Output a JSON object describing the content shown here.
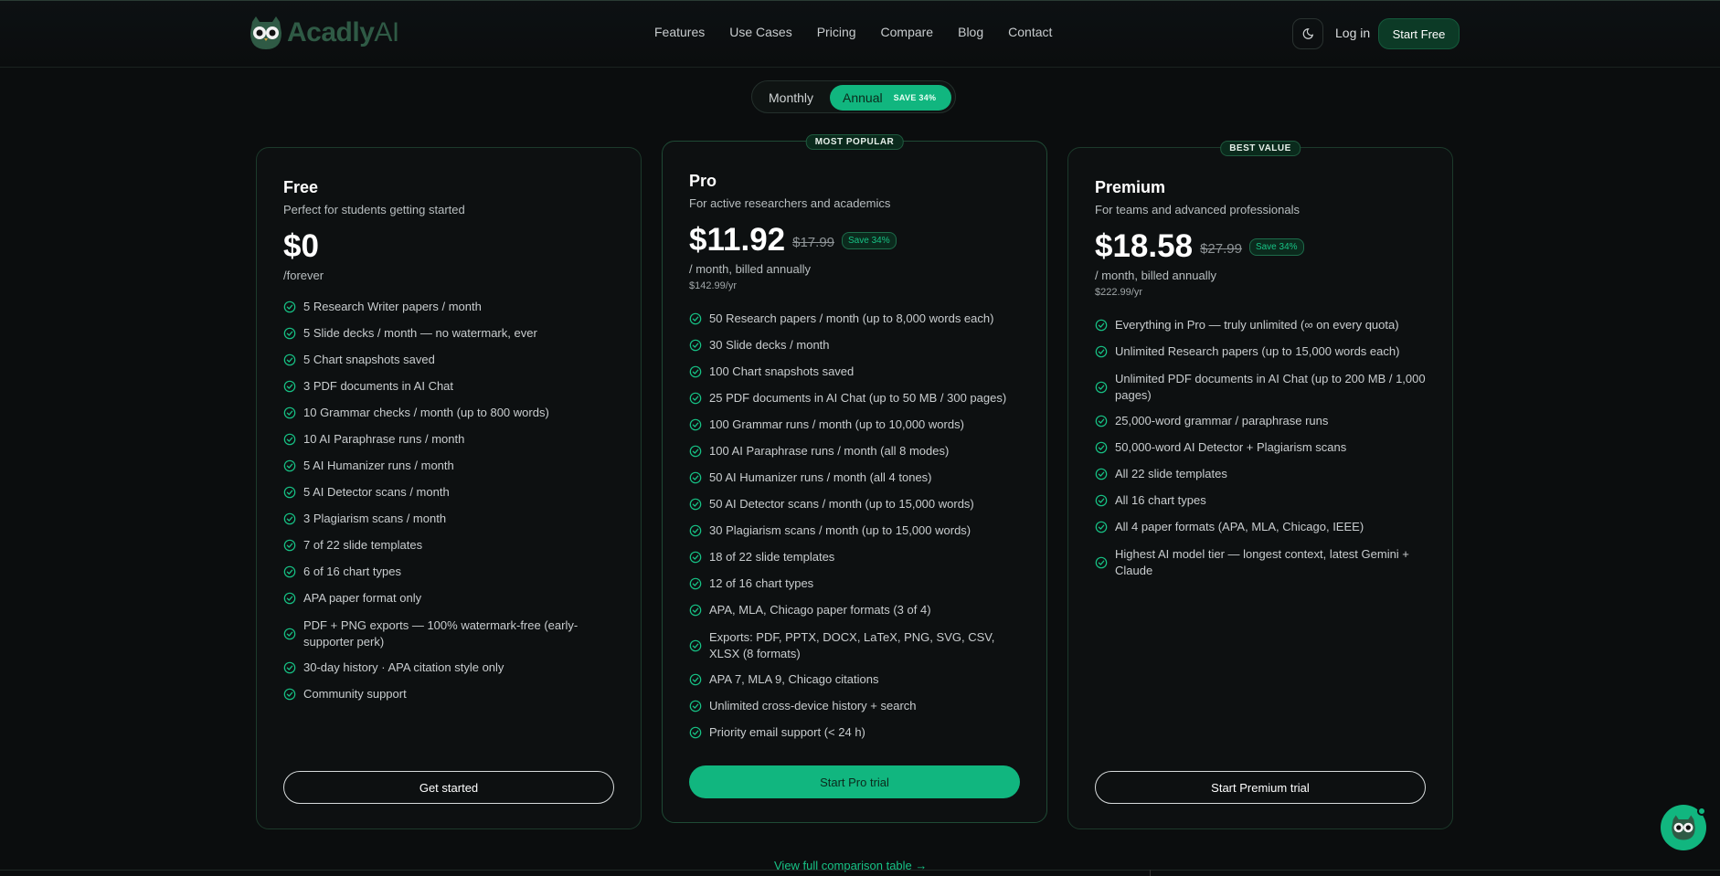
{
  "header": {
    "brand_main": "Acadly",
    "brand_ai": "AI",
    "nav": [
      "Features",
      "Use Cases",
      "Pricing",
      "Compare",
      "Blog",
      "Contact"
    ],
    "login": "Log in",
    "start_free": "Start Free"
  },
  "billing_toggle": {
    "monthly": "Monthly",
    "annual": "Annual",
    "save": "SAVE 34%"
  },
  "plans": {
    "free": {
      "name": "Free",
      "description": "Perfect for students getting started",
      "price": "$0",
      "period": "/forever",
      "features": [
        "5 Research Writer papers / month",
        "5 Slide decks / month — no watermark, ever",
        "5 Chart snapshots saved",
        "3 PDF documents in AI Chat",
        "10 Grammar checks / month (up to 800 words)",
        "10 AI Paraphrase runs / month",
        "5 AI Humanizer runs / month",
        "5 AI Detector scans / month",
        "3 Plagiarism scans / month",
        "7 of 22 slide templates",
        "6 of 16 chart types",
        "APA paper format only",
        "PDF + PNG exports — 100% watermark-free (early-supporter perk)",
        "30-day history · APA citation style only",
        "Community support"
      ],
      "cta": "Get started"
    },
    "pro": {
      "badge": "MOST POPULAR",
      "name": "Pro",
      "description": "For active researchers and academics",
      "price": "$11.92",
      "old_price": "$17.99",
      "save": "Save 34%",
      "period": "/ month, billed annually",
      "yearly": "$142.99/yr",
      "features": [
        "50 Research papers / month (up to 8,000 words each)",
        "30 Slide decks / month",
        "100 Chart snapshots saved",
        "25 PDF documents in AI Chat (up to 50 MB / 300 pages)",
        "100 Grammar runs / month (up to 10,000 words)",
        "100 AI Paraphrase runs / month (all 8 modes)",
        "50 AI Humanizer runs / month (all 4 tones)",
        "50 AI Detector scans / month (up to 15,000 words)",
        "30 Plagiarism scans / month (up to 15,000 words)",
        "18 of 22 slide templates",
        "12 of 16 chart types",
        "APA, MLA, Chicago paper formats (3 of 4)",
        "Exports: PDF, PPTX, DOCX, LaTeX, PNG, SVG, CSV, XLSX (8 formats)",
        "APA 7, MLA 9, Chicago citations",
        "Unlimited cross-device history + search",
        "Priority email support (< 24 h)"
      ],
      "cta": "Start Pro trial"
    },
    "premium": {
      "badge": "BEST VALUE",
      "name": "Premium",
      "description": "For teams and advanced professionals",
      "price": "$18.58",
      "old_price": "$27.99",
      "save": "Save 34%",
      "period": "/ month, billed annually",
      "yearly": "$222.99/yr",
      "features": [
        "Everything in Pro — truly unlimited (∞ on every quota)",
        "Unlimited Research papers (up to 15,000 words each)",
        "Unlimited PDF documents in AI Chat (up to 200 MB / 1,000 pages)",
        "25,000-word grammar / paraphrase runs",
        "50,000-word AI Detector + Plagiarism scans",
        "All 22 slide templates",
        "All 16 chart types",
        "All 4 paper formats (APA, MLA, Chicago, IEEE)",
        "Highest AI model tier — longest context, latest Gemini + Claude"
      ],
      "cta": "Start Premium trial"
    }
  },
  "compare_link": "View full comparison table →",
  "colors": {
    "accent": "#11b67f",
    "background": "#0b0d0e",
    "card_border": "#1c3a2b"
  }
}
